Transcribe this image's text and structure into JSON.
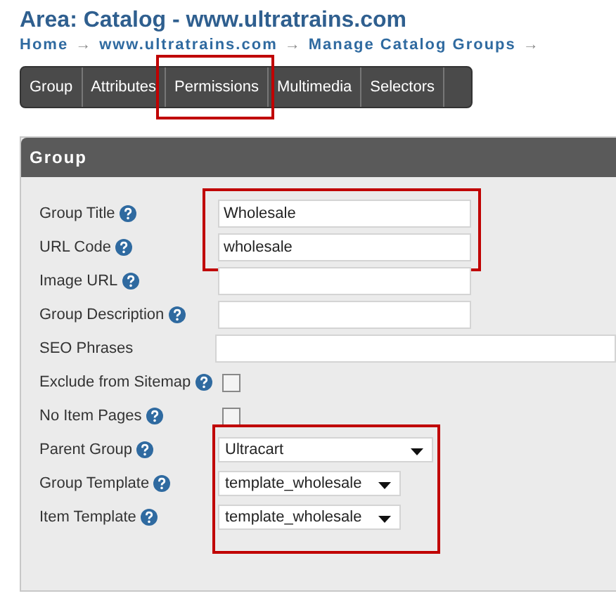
{
  "page_title": "Area: Catalog - www.ultratrains.com",
  "breadcrumbs": [
    "Home",
    "www.ultratrains.com",
    "Manage Catalog Groups"
  ],
  "breadcrumb_separator": "→",
  "tabs": [
    {
      "label": "Group",
      "selected": false,
      "highlighted": false
    },
    {
      "label": "Attributes",
      "selected": false,
      "highlighted": false
    },
    {
      "label": "Permissions",
      "selected": false,
      "highlighted": true
    },
    {
      "label": "Multimedia",
      "selected": false,
      "highlighted": false
    },
    {
      "label": "Selectors",
      "selected": false,
      "highlighted": false
    }
  ],
  "panel": {
    "title": "Group",
    "sections": [
      {
        "highlighted": true,
        "rows": [
          {
            "kind": "text",
            "label": "Group Title",
            "help": true,
            "value": "Wholesale",
            "wide": false
          },
          {
            "kind": "text",
            "label": "URL Code",
            "help": true,
            "value": "wholesale",
            "wide": false
          }
        ]
      },
      {
        "highlighted": false,
        "rows": [
          {
            "kind": "text",
            "label": "Image URL",
            "help": true,
            "wide": false
          },
          {
            "kind": "text",
            "label": "Group Description",
            "help": true,
            "wide": false
          },
          {
            "kind": "text",
            "label": "SEO Phrases",
            "help": false,
            "wide": true
          },
          {
            "kind": "checkbox",
            "label": "Exclude from Sitemap",
            "help": true,
            "checked": false
          },
          {
            "kind": "checkbox",
            "label": "No Item Pages",
            "help": true,
            "checked": false
          }
        ]
      },
      {
        "highlighted": true,
        "rows": [
          {
            "kind": "select",
            "label": "Parent Group",
            "help": true,
            "value": "Ultracart"
          },
          {
            "kind": "select",
            "label": "Group Template",
            "help": true,
            "value": "template_wholesale"
          },
          {
            "kind": "select",
            "label": "Item Template",
            "help": true,
            "value": "template_wholesale"
          }
        ]
      }
    ]
  }
}
